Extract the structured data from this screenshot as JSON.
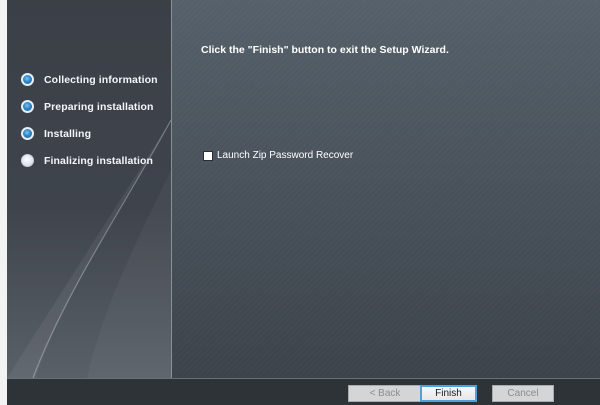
{
  "wizard": {
    "steps": [
      {
        "label": "Collecting information",
        "state": "done"
      },
      {
        "label": "Preparing installation",
        "state": "done"
      },
      {
        "label": "Installing",
        "state": "done"
      },
      {
        "label": "Finalizing installation",
        "state": "current"
      }
    ],
    "instruction": "Click the \"Finish\" button to exit the Setup Wizard.",
    "launch_checkbox": {
      "label": "Launch Zip Password Recover",
      "checked": false
    },
    "buttons": {
      "back": "< Back",
      "finish": "Finish",
      "cancel": "Cancel"
    }
  },
  "colors": {
    "step_done": "#2d86c8",
    "primary_button_border": "#4aa3df",
    "panel_background": "#4a525b"
  }
}
